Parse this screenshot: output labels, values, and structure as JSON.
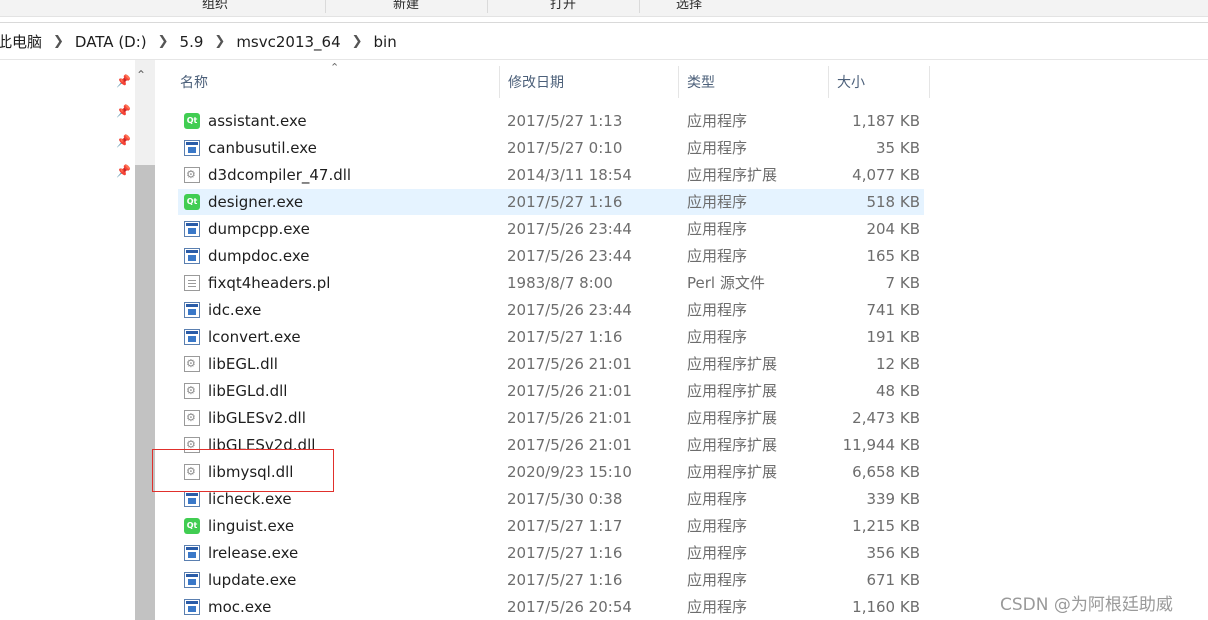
{
  "ribbon": {
    "groups": [
      "组织",
      "新建",
      "打开",
      "选择"
    ]
  },
  "address": {
    "crumbs": [
      "此电脑",
      "DATA (D:)",
      "5.9",
      "msvc2013_64",
      "bin"
    ]
  },
  "columns": {
    "name": "名称",
    "date": "修改日期",
    "type": "类型",
    "size": "大小"
  },
  "files": [
    {
      "name": "assistant.exe",
      "date": "2017/5/27 1:13",
      "type": "应用程序",
      "size": "1,187 KB",
      "icon": "qt-app-icon"
    },
    {
      "name": "canbusutil.exe",
      "date": "2017/5/27 0:10",
      "type": "应用程序",
      "size": "35 KB",
      "icon": "exe-icon"
    },
    {
      "name": "d3dcompiler_47.dll",
      "date": "2014/3/11 18:54",
      "type": "应用程序扩展",
      "size": "4,077 KB",
      "icon": "dll-icon"
    },
    {
      "name": "designer.exe",
      "date": "2017/5/27 1:16",
      "type": "应用程序",
      "size": "518 KB",
      "icon": "qt-app-icon"
    },
    {
      "name": "dumpcpp.exe",
      "date": "2017/5/26 23:44",
      "type": "应用程序",
      "size": "204 KB",
      "icon": "exe-icon"
    },
    {
      "name": "dumpdoc.exe",
      "date": "2017/5/26 23:44",
      "type": "应用程序",
      "size": "165 KB",
      "icon": "exe-icon"
    },
    {
      "name": "fixqt4headers.pl",
      "date": "1983/8/7 8:00",
      "type": "Perl 源文件",
      "size": "7 KB",
      "icon": "text-file-icon"
    },
    {
      "name": "idc.exe",
      "date": "2017/5/26 23:44",
      "type": "应用程序",
      "size": "741 KB",
      "icon": "exe-icon"
    },
    {
      "name": "lconvert.exe",
      "date": "2017/5/27 1:16",
      "type": "应用程序",
      "size": "191 KB",
      "icon": "exe-icon"
    },
    {
      "name": "libEGL.dll",
      "date": "2017/5/26 21:01",
      "type": "应用程序扩展",
      "size": "12 KB",
      "icon": "dll-icon"
    },
    {
      "name": "libEGLd.dll",
      "date": "2017/5/26 21:01",
      "type": "应用程序扩展",
      "size": "48 KB",
      "icon": "dll-icon"
    },
    {
      "name": "libGLESv2.dll",
      "date": "2017/5/26 21:01",
      "type": "应用程序扩展",
      "size": "2,473 KB",
      "icon": "dll-icon"
    },
    {
      "name": "libGLESv2d.dll",
      "date": "2017/5/26 21:01",
      "type": "应用程序扩展",
      "size": "11,944 KB",
      "icon": "dll-icon"
    },
    {
      "name": "libmysql.dll",
      "date": "2020/9/23 15:10",
      "type": "应用程序扩展",
      "size": "6,658 KB",
      "icon": "dll-icon"
    },
    {
      "name": "licheck.exe",
      "date": "2017/5/30 0:38",
      "type": "应用程序",
      "size": "339 KB",
      "icon": "exe-icon"
    },
    {
      "name": "linguist.exe",
      "date": "2017/5/27 1:17",
      "type": "应用程序",
      "size": "1,215 KB",
      "icon": "qt-app-icon"
    },
    {
      "name": "lrelease.exe",
      "date": "2017/5/27 1:16",
      "type": "应用程序",
      "size": "356 KB",
      "icon": "exe-icon"
    },
    {
      "name": "lupdate.exe",
      "date": "2017/5/27 1:16",
      "type": "应用程序",
      "size": "671 KB",
      "icon": "exe-icon"
    },
    {
      "name": "moc.exe",
      "date": "2017/5/26 20:54",
      "type": "应用程序",
      "size": "1,160 KB",
      "icon": "exe-icon"
    }
  ],
  "selected_file": "designer.exe",
  "highlighted_file": "libmysql.dll",
  "watermark": "CSDN @为阿根廷助威",
  "colors": {
    "selection": "#e5f3ff",
    "highlight_border": "#e0302c",
    "qt_green": "#41cd52"
  }
}
